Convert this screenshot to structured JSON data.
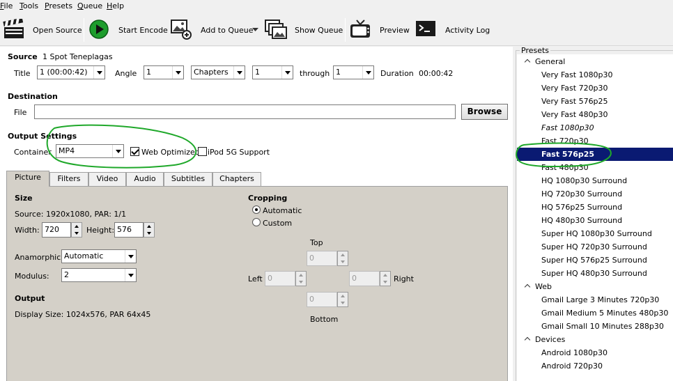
{
  "menu": {
    "items": [
      {
        "key": "F",
        "rest": "ile"
      },
      {
        "key": "T",
        "rest": "ools"
      },
      {
        "key": "P",
        "rest": "resets"
      },
      {
        "key": "Q",
        "rest": "ueue"
      },
      {
        "key": "H",
        "rest": "elp"
      }
    ]
  },
  "toolbar": {
    "open_source": "Open Source",
    "start_encode": "Start Encode",
    "add_to_queue": "Add to Queue",
    "show_queue": "Show Queue",
    "preview": "Preview",
    "activity_log": "Activity Log"
  },
  "source": {
    "heading": "Source",
    "name": "1 Spot Teneplagas",
    "title_label": "Title",
    "title_value": "1 (00:00:42)",
    "angle_label": "Angle",
    "angle_value": "1",
    "mode_value": "Chapters",
    "from_value": "1",
    "through_label": "through",
    "to_value": "1",
    "duration_label": "Duration",
    "duration_value": "00:00:42"
  },
  "destination": {
    "heading": "Destination",
    "file_label": "File",
    "file_value": "",
    "browse": "Browse"
  },
  "output_settings": {
    "heading": "Output Settings",
    "container_label": "Container",
    "container_value": "MP4",
    "web_optimized": "Web Optimized",
    "web_optimized_checked": true,
    "ipod_support": "iPod 5G Support",
    "ipod_checked": false
  },
  "tabs": [
    "Picture",
    "Filters",
    "Video",
    "Audio",
    "Subtitles",
    "Chapters"
  ],
  "picture": {
    "size_heading": "Size",
    "source_info": "Source:  1920x1080, PAR: 1/1",
    "width_label": "Width:",
    "width_value": "720",
    "height_label": "Height:",
    "height_value": "576",
    "anamorphic_label": "Anamorphic:",
    "anamorphic_value": "Automatic",
    "modulus_label": "Modulus:",
    "modulus_value": "2",
    "output_heading": "Output",
    "display_size": "Display Size: 1024x576,  PAR 64x45",
    "cropping_heading": "Cropping",
    "crop_automatic": "Automatic",
    "crop_custom": "Custom",
    "top_label": "Top",
    "top_value": "0",
    "left_label": "Left",
    "left_value": "0",
    "right_label": "Right",
    "right_value": "0",
    "bottom_label": "Bottom",
    "bottom_value": "0"
  },
  "presets": {
    "legend": "Presets",
    "groups": [
      {
        "name": "General",
        "items": [
          {
            "label": "Very Fast 1080p30"
          },
          {
            "label": "Very Fast 720p30"
          },
          {
            "label": "Very Fast 576p25"
          },
          {
            "label": "Very Fast 480p30"
          },
          {
            "label": "Fast 1080p30",
            "italic": true
          },
          {
            "label": "Fast 720p30"
          },
          {
            "label": "Fast 576p25",
            "selected": true
          },
          {
            "label": "Fast 480p30"
          },
          {
            "label": "HQ 1080p30 Surround"
          },
          {
            "label": "HQ 720p30 Surround"
          },
          {
            "label": "HQ 576p25 Surround"
          },
          {
            "label": "HQ 480p30 Surround"
          },
          {
            "label": "Super HQ 1080p30 Surround"
          },
          {
            "label": "Super HQ 720p30 Surround"
          },
          {
            "label": "Super HQ 576p25 Surround"
          },
          {
            "label": "Super HQ 480p30 Surround"
          }
        ]
      },
      {
        "name": "Web",
        "items": [
          {
            "label": "Gmail Large 3 Minutes 720p30"
          },
          {
            "label": "Gmail Medium 5 Minutes 480p30"
          },
          {
            "label": "Gmail Small 10 Minutes 288p30"
          }
        ]
      },
      {
        "name": "Devices",
        "items": [
          {
            "label": "Android 1080p30"
          },
          {
            "label": "Android 720p30"
          }
        ]
      }
    ]
  },
  "colors": {
    "annotation": "#1fa82a",
    "selection": "#0a1a72",
    "panel": "#d4d0c8"
  }
}
